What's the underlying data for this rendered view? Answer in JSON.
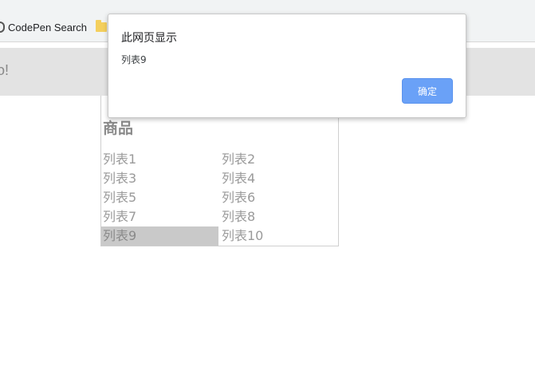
{
  "bookmarks": {
    "items": [
      {
        "label": "CodePen Search",
        "icon": "codepen-icon"
      },
      {
        "label": "",
        "icon": "folder-icon"
      }
    ]
  },
  "page": {
    "banner_text": "o!",
    "product_title": "商品",
    "list": [
      {
        "label": "列表1",
        "selected": false
      },
      {
        "label": "列表2",
        "selected": false
      },
      {
        "label": "列表3",
        "selected": false
      },
      {
        "label": "列表4",
        "selected": false
      },
      {
        "label": "列表5",
        "selected": false
      },
      {
        "label": "列表6",
        "selected": false
      },
      {
        "label": "列表7",
        "selected": false
      },
      {
        "label": "列表8",
        "selected": false
      },
      {
        "label": "列表9",
        "selected": true
      },
      {
        "label": "列表10",
        "selected": false
      }
    ]
  },
  "alert": {
    "title": "此网页显示",
    "message": "列表9",
    "ok_label": "确定"
  },
  "colors": {
    "ok_button": "#6aa1f7",
    "selected_row": "#c9c9c9",
    "banner": "#e3e3e3"
  }
}
